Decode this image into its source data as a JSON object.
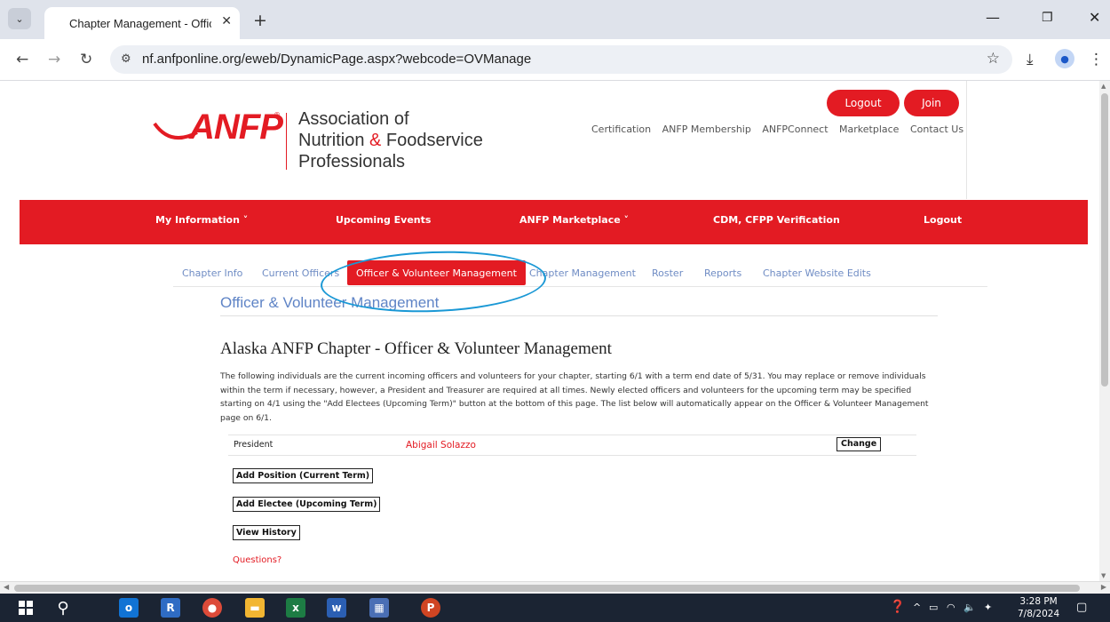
{
  "browser": {
    "tab_title": "Chapter Management - Officer",
    "url": "nf.anfponline.org/eweb/DynamicPage.aspx?webcode=OVManage"
  },
  "header": {
    "logo_text": "ANFP",
    "association_lines": [
      "Association of",
      "Nutrition ",
      "&",
      " Foodservice",
      "Professionals"
    ],
    "top_links": [
      "Certification",
      "ANFP Membership",
      "ANFPConnect",
      "Marketplace",
      "Contact Us"
    ],
    "logout_label": "Logout",
    "join_label": "Join"
  },
  "main_nav": {
    "items": [
      "My Information ˅",
      "Upcoming Events",
      "ANFP Marketplace ˅",
      "CDM, CFPP Verification",
      "Logout"
    ]
  },
  "sub_tabs": {
    "items": [
      "Chapter Info",
      "Current Officers",
      "Officer & Volunteer Management",
      "Chapter Management",
      "Roster",
      "Reports",
      "Chapter Website Edits"
    ],
    "active_index": 2
  },
  "content": {
    "section_heading": "Officer & Volunteer Management",
    "page_title": "Alaska ANFP Chapter - Officer & Volunteer Management",
    "intro": "The following individuals are the current incoming officers and volunteers for your chapter, starting 6/1 with a term end date of 5/31. You may replace or remove individuals within the term if necessary, however, a President and Treasurer are required at all times. Newly elected officers and volunteers for the upcoming term may be specified starting on 4/1 using the \"Add Electees (Upcoming Term)\" button at the bottom of this page. The list below will automatically appear on the Officer & Volunteer Management page on 6/1.",
    "officers": [
      {
        "position": "President",
        "name": "Abigail Solazzo",
        "action": "Change"
      }
    ],
    "buttons": {
      "add_position": "Add Position (Current Term)",
      "add_electee": "Add Electee (Upcoming Term)",
      "view_history": "View History"
    },
    "questions_link": "Questions?"
  },
  "taskbar": {
    "time": "3:28 PM",
    "date": "7/8/2024"
  },
  "colors": {
    "brand_red": "#e31b23",
    "link_blue": "#6f8cc4",
    "annotation_blue": "#1a98d5"
  }
}
